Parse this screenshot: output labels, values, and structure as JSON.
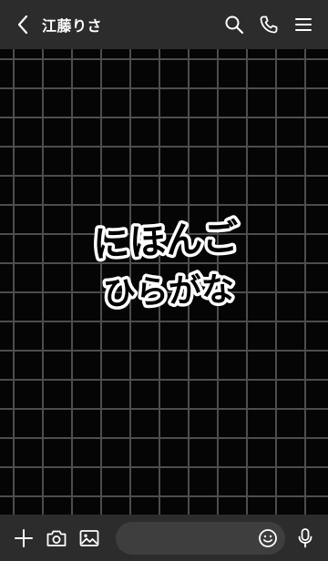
{
  "header": {
    "back_icon": "chevron-left-icon",
    "title": "江藤りさ",
    "search_icon": "search-icon",
    "call_icon": "phone-icon",
    "menu_icon": "menu-icon",
    "background": "#2c2c2c"
  },
  "chat": {
    "background": "#050505",
    "grid_color": "#4d4d4d",
    "decor_text_line1": "にほんご",
    "decor_text_line2": "ひらがな"
  },
  "footer": {
    "add_icon": "plus-icon",
    "camera_icon": "camera-icon",
    "image_icon": "image-icon",
    "message_placeholder": "",
    "emoji_icon": "emoji-icon",
    "mic_icon": "microphone-icon",
    "background": "#2c2c2c"
  }
}
